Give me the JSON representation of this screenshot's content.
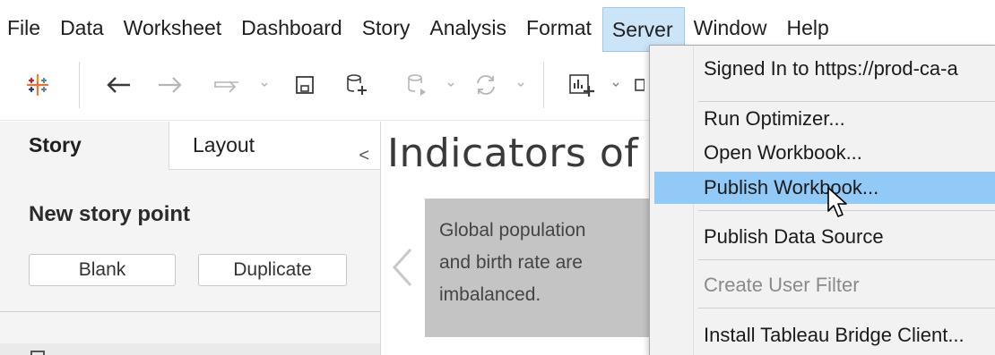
{
  "menubar": {
    "items": [
      "File",
      "Data",
      "Worksheet",
      "Dashboard",
      "Story",
      "Analysis",
      "Format",
      "Server",
      "Window",
      "Help"
    ],
    "active": "Server"
  },
  "toolbar": {
    "icons": [
      "tableau-logo-icon",
      "undo-icon",
      "redo-icon",
      "replay-icon",
      "save-icon",
      "new-data-source-icon",
      "pause-auto-updates-icon",
      "refresh-icon",
      "new-worksheet-icon"
    ]
  },
  "left_pane": {
    "tab_story": "Story",
    "tab_layout": "Layout",
    "collapse_glyph": "<",
    "new_story_point_title": "New story point",
    "blank_label": "Blank",
    "duplicate_label": "Duplicate"
  },
  "story": {
    "title": "Indicators of",
    "prev_glyph": "<",
    "card_text_lines": [
      "Global population",
      "and birth rate are",
      "imbalanced."
    ]
  },
  "server_menu": {
    "signed_in": "Signed In to https://prod-ca-a",
    "run_optimizer": "Run Optimizer...",
    "open_workbook": "Open Workbook...",
    "publish_workbook": "Publish Workbook...",
    "publish_data_source": "Publish Data Source",
    "create_user_filter": "Create User Filter",
    "install_bridge": "Install Tableau Bridge Client...",
    "highlighted": "Publish Workbook..."
  },
  "colors": {
    "menu_active_bg": "#cce4f7",
    "menu_highlight_bg": "#91c9f7",
    "story_card_bg": "#c4c4c4",
    "disabled_text": "#8a8a8a"
  }
}
